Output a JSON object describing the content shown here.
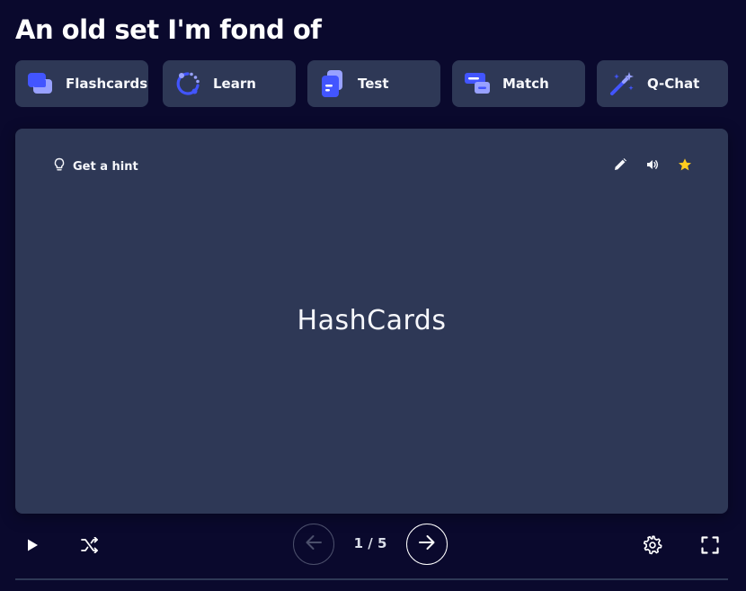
{
  "set": {
    "title": "An old set I'm fond of"
  },
  "modes": [
    {
      "label": "Flashcards",
      "icon": "flashcards-icon"
    },
    {
      "label": "Learn",
      "icon": "learn-icon"
    },
    {
      "label": "Test",
      "icon": "test-icon"
    },
    {
      "label": "Match",
      "icon": "match-icon"
    },
    {
      "label": "Q-Chat",
      "icon": "magic-wand-icon"
    }
  ],
  "card": {
    "hint_label": "Get a hint",
    "term": "HashCards",
    "starred": true
  },
  "controls": {
    "counter": "1 / 5"
  },
  "colors": {
    "background": "#0a092d",
    "surface": "#2e3856",
    "accent": "#4255ff",
    "star": "#ffcd1f"
  }
}
